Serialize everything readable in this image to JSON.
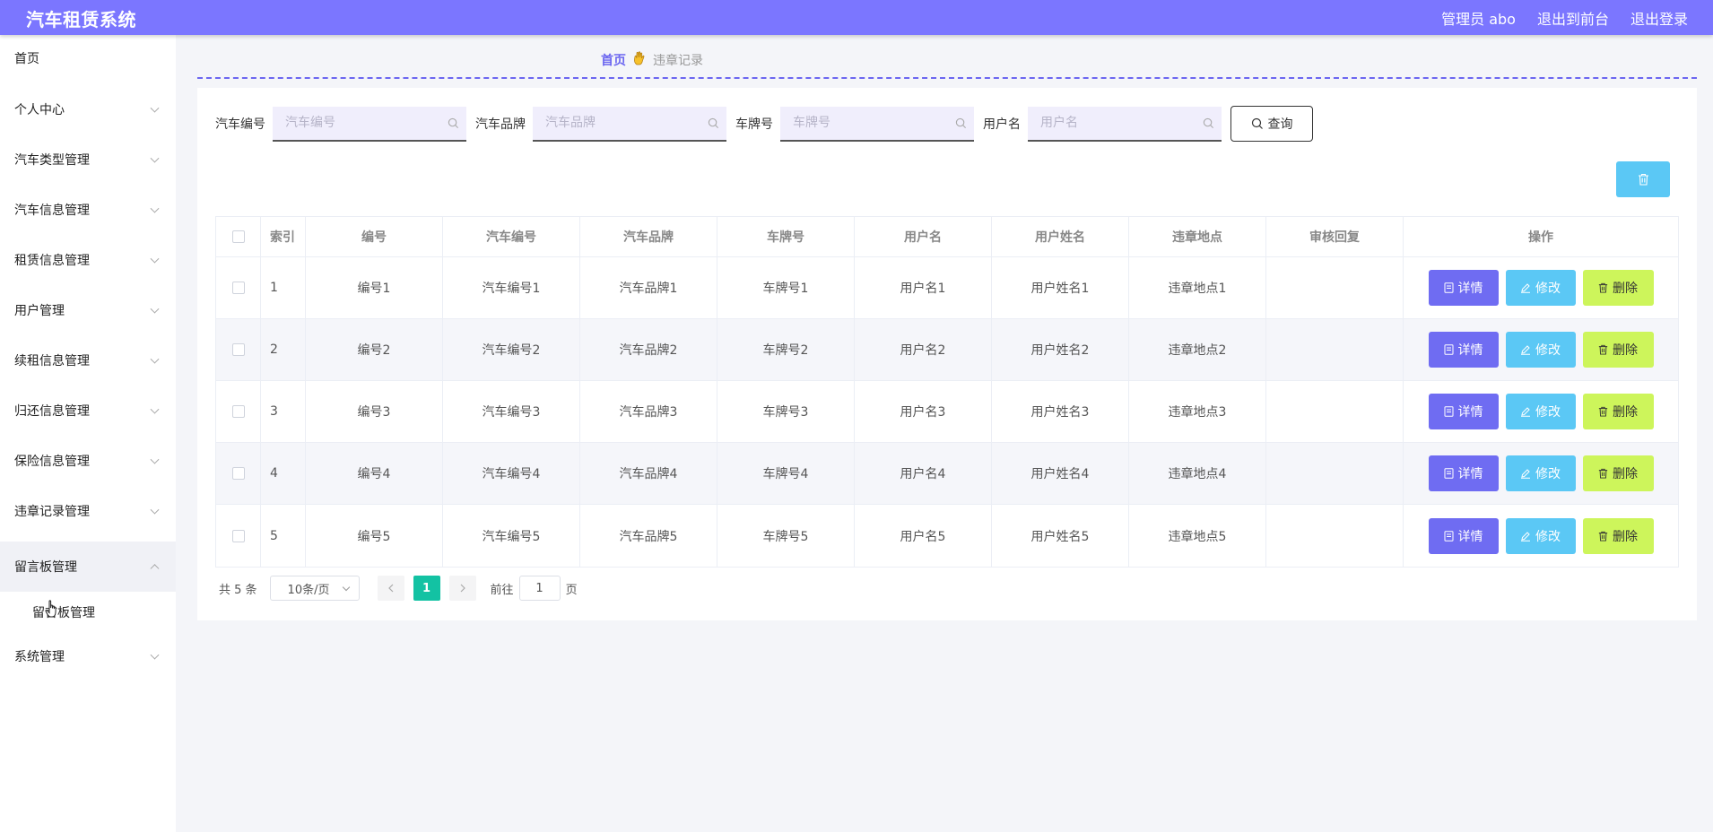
{
  "app": {
    "title": "汽车租赁系统"
  },
  "header": {
    "admin_label": "管理员 abo",
    "back_to_front": "退出到前台",
    "logout": "退出登录"
  },
  "sidebar": {
    "items": [
      {
        "label": "首页"
      },
      {
        "label": "个人中心"
      },
      {
        "label": "汽车类型管理"
      },
      {
        "label": "汽车信息管理"
      },
      {
        "label": "租赁信息管理"
      },
      {
        "label": "用户管理"
      },
      {
        "label": "续租信息管理"
      },
      {
        "label": "归还信息管理"
      },
      {
        "label": "保险信息管理"
      },
      {
        "label": "违章记录管理"
      },
      {
        "label": "留言板管理"
      },
      {
        "label": "系统管理"
      }
    ],
    "submenu": {
      "label": "留言板管理"
    }
  },
  "breadcrumb": {
    "home": "首页",
    "separator_icon": "hand-icon",
    "current": "违章记录"
  },
  "search": {
    "car_no_label": "汽车编号",
    "car_no_placeholder": "汽车编号",
    "brand_label": "汽车品牌",
    "brand_placeholder": "汽车品牌",
    "plate_label": "车牌号",
    "plate_placeholder": "车牌号",
    "user_label": "用户名",
    "user_placeholder": "用户名",
    "query_button": "查询"
  },
  "table": {
    "headers": [
      "索引",
      "编号",
      "汽车编号",
      "汽车品牌",
      "车牌号",
      "用户名",
      "用户姓名",
      "违章地点",
      "审核回复",
      "操作"
    ],
    "rows": [
      {
        "index": "1",
        "code": "编号1",
        "car_no": "汽车编号1",
        "brand": "汽车品牌1",
        "plate": "车牌号1",
        "username": "用户名1",
        "realname": "用户姓名1",
        "place": "违章地点1",
        "reply": ""
      },
      {
        "index": "2",
        "code": "编号2",
        "car_no": "汽车编号2",
        "brand": "汽车品牌2",
        "plate": "车牌号2",
        "username": "用户名2",
        "realname": "用户姓名2",
        "place": "违章地点2",
        "reply": ""
      },
      {
        "index": "3",
        "code": "编号3",
        "car_no": "汽车编号3",
        "brand": "汽车品牌3",
        "plate": "车牌号3",
        "username": "用户名3",
        "realname": "用户姓名3",
        "place": "违章地点3",
        "reply": ""
      },
      {
        "index": "4",
        "code": "编号4",
        "car_no": "汽车编号4",
        "brand": "汽车品牌4",
        "plate": "车牌号4",
        "username": "用户名4",
        "realname": "用户姓名4",
        "place": "违章地点4",
        "reply": ""
      },
      {
        "index": "5",
        "code": "编号5",
        "car_no": "汽车编号5",
        "brand": "汽车品牌5",
        "plate": "车牌号5",
        "username": "用户名5",
        "realname": "用户姓名5",
        "place": "违章地点5",
        "reply": ""
      }
    ],
    "actions": {
      "detail": "详情",
      "edit": "修改",
      "delete": "删除"
    }
  },
  "pagination": {
    "total": "共 5 条",
    "page_size": "10条/页",
    "current_page": "1",
    "goto_prefix": "前往",
    "goto_value": "1",
    "goto_suffix": "页"
  },
  "colors": {
    "header_bg": "#7b76ff",
    "detail_btn": "#6f6cf2",
    "edit_btn": "#5bc8f5",
    "delete_btn": "#cdf55b",
    "page_active": "#13c2a3"
  }
}
